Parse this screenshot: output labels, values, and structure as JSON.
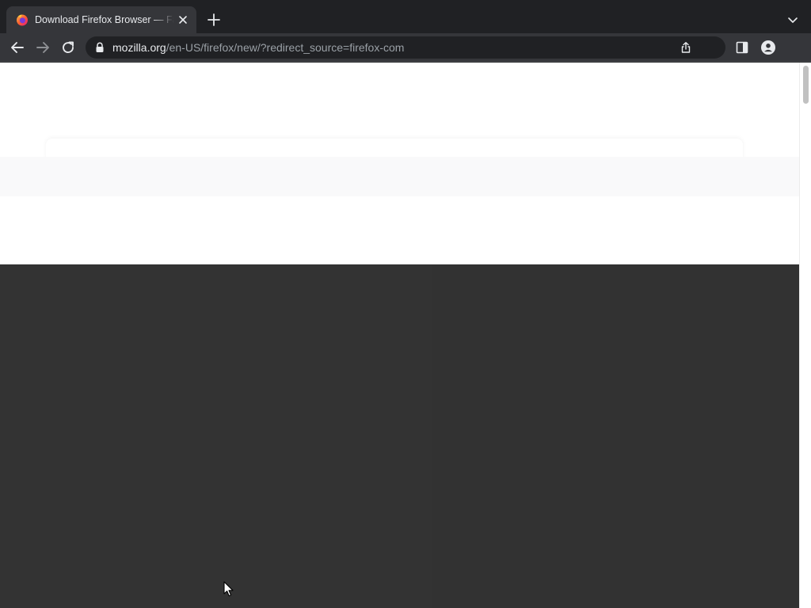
{
  "browser": {
    "tab": {
      "title": "Download Firefox Browser — Fast, Private & Free — from Mozilla",
      "favicon": "firefox-icon",
      "close_icon": "close-icon"
    },
    "new_tab_icon": "plus-icon",
    "tab_search_icon": "chevron-down-icon",
    "toolbar": {
      "back_icon": "arrow-left-icon",
      "forward_icon": "arrow-right-icon",
      "reload_icon": "reload-icon",
      "side_panel_icon": "side-panel-icon",
      "profile_icon": "profile-icon"
    },
    "address_bar": {
      "lock_icon": "lock-icon",
      "host": "mozilla.org",
      "path": "/en-US/firefox/new/?redirect_source=firefox-com",
      "share_icon": "share-icon"
    }
  },
  "colors": {
    "tabstrip_bg": "#202124",
    "toolbar_bg": "#35363a",
    "page_bg": "#ffffff",
    "page_band": "#f9f9fa",
    "page_dark": "#333333",
    "text_primary": "#e8eaed",
    "text_secondary": "#9aa0a6"
  }
}
